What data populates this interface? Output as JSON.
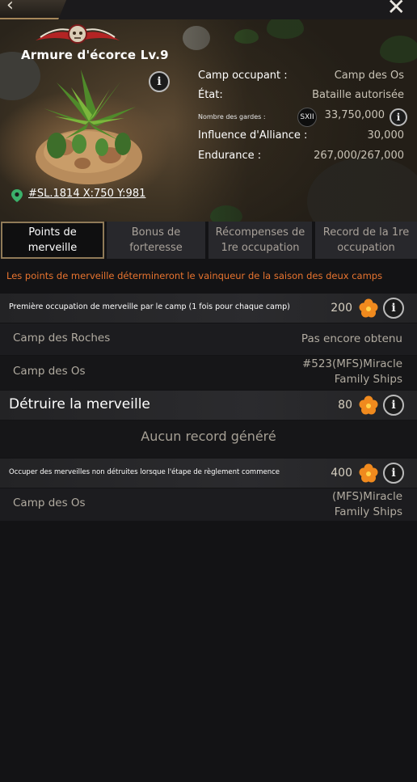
{
  "building": {
    "title": "Armure d'écorce Lv.9",
    "coordinates": "#SL.1814  X:750  Y:981"
  },
  "stats": [
    {
      "label": "Camp occupant :",
      "value": "Camp des Os"
    },
    {
      "label": "État:",
      "value": "Bataille autorisée"
    },
    {
      "label": "Nombre des gardes :",
      "badge": "SXII",
      "value": "33,750,000"
    },
    {
      "label": "Influence d'Alliance :",
      "value": "30,000"
    },
    {
      "label": "Endurance :",
      "value": "267,000/267,000"
    }
  ],
  "tabs": [
    {
      "label": "Points de merveille",
      "active": true
    },
    {
      "label": "Bonus de forteresse",
      "active": false
    },
    {
      "label": "Récompenses de 1re occupation",
      "active": false
    },
    {
      "label": "Record de la 1re occupation",
      "active": false
    }
  ],
  "notice": "Les points de merveille détermineront le vainqueur de la saison des deux camps",
  "sections": [
    {
      "label": "Première occupation de merveille par le camp (1 fois pour chaque camp)",
      "points": "200",
      "rows": [
        {
          "camp": "Camp des Roches",
          "status": "Pas encore obtenu"
        },
        {
          "camp": "Camp des Os",
          "status": "#523(MFS)Miracle Family Ships"
        }
      ]
    },
    {
      "label": "Détruire la merveille",
      "points": "80",
      "empty_message": "Aucun record généré"
    },
    {
      "label": "Occuper des merveilles non détruites lorsque l'étape de règlement commence",
      "points": "400",
      "rows": [
        {
          "camp": "Camp des Os",
          "status": "(MFS)Miracle Family Ships"
        }
      ]
    }
  ],
  "colors": {
    "accent": "#e8742f",
    "tab_border": "#8f7a58",
    "background": "#131315"
  }
}
